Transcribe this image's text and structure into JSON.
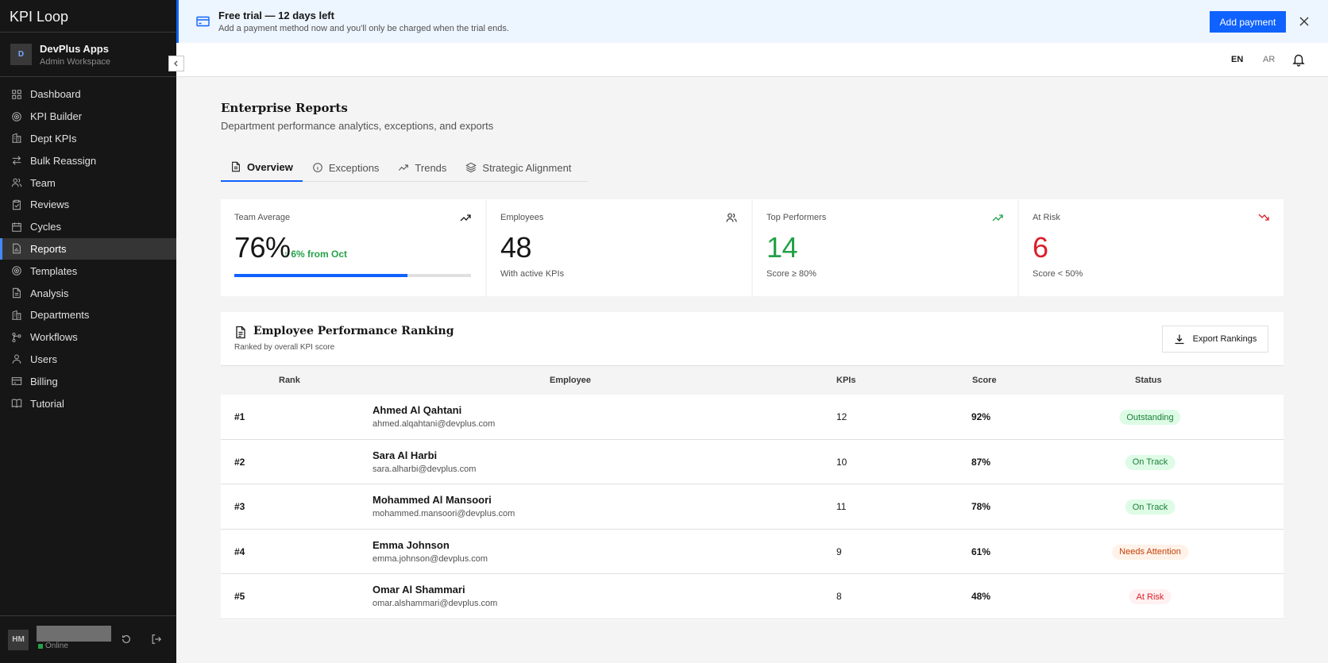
{
  "app": {
    "title": "KPI Loop"
  },
  "workspace": {
    "initial": "D",
    "name": "DevPlus Apps",
    "subtitle": "Admin Workspace"
  },
  "sidebar": {
    "items": [
      {
        "label": "Dashboard",
        "icon": "dashboard-icon",
        "active": false
      },
      {
        "label": "KPI Builder",
        "icon": "target-icon",
        "active": false
      },
      {
        "label": "Dept KPIs",
        "icon": "building-icon",
        "active": false
      },
      {
        "label": "Bulk Reassign",
        "icon": "swap-icon",
        "active": false
      },
      {
        "label": "Team",
        "icon": "team-icon",
        "active": false
      },
      {
        "label": "Reviews",
        "icon": "clipboard-icon",
        "active": false
      },
      {
        "label": "Cycles",
        "icon": "calendar-icon",
        "active": false
      },
      {
        "label": "Reports",
        "icon": "report-icon",
        "active": true
      },
      {
        "label": "Templates",
        "icon": "target-icon",
        "active": false
      },
      {
        "label": "Analysis",
        "icon": "document-icon",
        "active": false
      },
      {
        "label": "Departments",
        "icon": "building-icon",
        "active": false
      },
      {
        "label": "Workflows",
        "icon": "workflow-icon",
        "active": false
      },
      {
        "label": "Users",
        "icon": "users-icon",
        "active": false
      },
      {
        "label": "Billing",
        "icon": "card-icon",
        "active": false
      },
      {
        "label": "Tutorial",
        "icon": "book-icon",
        "active": false
      }
    ]
  },
  "user": {
    "initials": "HM",
    "status": "Online"
  },
  "banner": {
    "title": "Free trial — 12 days left",
    "text": "Add a payment method now and you'll only be charged when the trial ends.",
    "button": "Add payment"
  },
  "topbar": {
    "lang_en": "EN",
    "lang_ar": "AR"
  },
  "page": {
    "title": "Enterprise Reports",
    "subtitle": "Department performance analytics, exceptions, and exports"
  },
  "tabs": [
    {
      "label": "Overview",
      "icon": "document-icon",
      "active": true
    },
    {
      "label": "Exceptions",
      "icon": "info-icon",
      "active": false
    },
    {
      "label": "Trends",
      "icon": "trend-icon",
      "active": false
    },
    {
      "label": "Strategic Alignment",
      "icon": "layers-icon",
      "active": false
    }
  ],
  "kpis": {
    "team_average": {
      "label": "Team Average",
      "value": "76%",
      "delta": "↑ 6% from Oct",
      "progress": 0.73
    },
    "employees": {
      "label": "Employees",
      "value": "48",
      "note": "With active KPIs"
    },
    "top_performers": {
      "label": "Top Performers",
      "value": "14",
      "note": "Score ≥ 80%"
    },
    "at_risk": {
      "label": "At Risk",
      "value": "6",
      "note": "Score < 50%"
    }
  },
  "colors": {
    "accent": "#0f62fe",
    "green": "#24a148",
    "red": "#da1e28",
    "orange": "#c2410c"
  },
  "ranking": {
    "title": "Employee Performance Ranking",
    "subtitle": "Ranked by overall KPI score",
    "export_label": "Export Rankings",
    "columns": [
      "Rank",
      "Employee",
      "KPIs",
      "Score",
      "Status"
    ],
    "rows": [
      {
        "rank": "#1",
        "name": "Ahmed Al Qahtani",
        "email": "ahmed.alqahtani@devplus.com",
        "kpis": "12",
        "score": "92%",
        "status": "Outstanding"
      },
      {
        "rank": "#2",
        "name": "Sara Al Harbi",
        "email": "sara.alharbi@devplus.com",
        "kpis": "10",
        "score": "87%",
        "status": "On Track"
      },
      {
        "rank": "#3",
        "name": "Mohammed Al Mansoori",
        "email": "mohammed.mansoori@devplus.com",
        "kpis": "11",
        "score": "78%",
        "status": "On Track"
      },
      {
        "rank": "#4",
        "name": "Emma Johnson",
        "email": "emma.johnson@devplus.com",
        "kpis": "9",
        "score": "61%",
        "status": "Needs Attention"
      },
      {
        "rank": "#5",
        "name": "Omar Al Shammari",
        "email": "omar.alshammari@devplus.com",
        "kpis": "8",
        "score": "48%",
        "status": "At Risk"
      }
    ]
  }
}
